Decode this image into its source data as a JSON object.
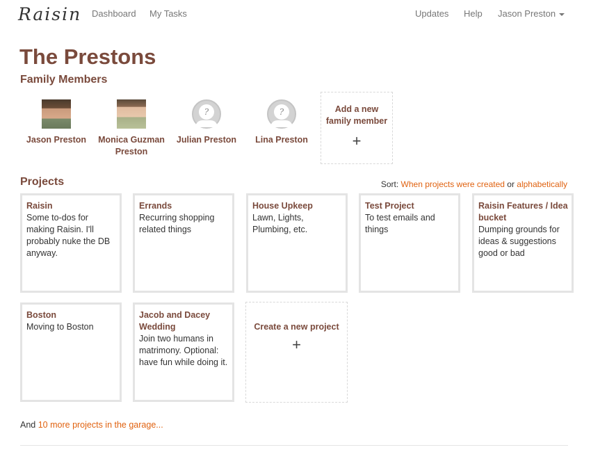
{
  "nav": {
    "brand": "Raisin",
    "links": [
      "Dashboard",
      "My Tasks"
    ],
    "right_links": [
      "Updates",
      "Help"
    ],
    "user": "Jason Preston"
  },
  "page": {
    "title": "The Prestons",
    "members_heading": "Family Members",
    "projects_heading": "Projects"
  },
  "members": [
    {
      "name": "Jason Preston",
      "avatar": "photo"
    },
    {
      "name": "Monica Guzman Preston",
      "avatar": "photo"
    },
    {
      "name": "Julian Preston",
      "avatar": "default-avatar-icon"
    },
    {
      "name": "Lina Preston",
      "avatar": "default-avatar-icon"
    }
  ],
  "add_member": {
    "label": "Add a new family member",
    "icon": "+"
  },
  "sort": {
    "prefix": "Sort:",
    "option_created": "When projects were created",
    "separator": "or",
    "option_alpha": "alphabetically"
  },
  "projects": [
    {
      "title": "Raisin",
      "desc": "Some to-dos for making Raisin. I'll probably nuke the DB anyway."
    },
    {
      "title": "Errands",
      "desc": "Recurring shopping related things"
    },
    {
      "title": "House Upkeep",
      "desc": "Lawn, Lights, Plumbing, etc."
    },
    {
      "title": "Test Project",
      "desc": "To test emails and things"
    },
    {
      "title": "Raisin Features / Idea bucket",
      "desc": "Dumping grounds for ideas & suggestions good or bad"
    },
    {
      "title": "Boston",
      "desc": "Moving to Boston"
    },
    {
      "title": "Jacob and Dacey Wedding",
      "desc": "Join two humans in matrimony. Optional: have fun while doing it."
    }
  ],
  "new_project": {
    "label": "Create a new project",
    "icon": "+"
  },
  "footer": {
    "prefix": "And",
    "link": "10 more projects in the garage..."
  },
  "colors": {
    "accent_brown": "#7a4a3c",
    "link_orange": "#e06210",
    "card_border": "#e4e4e4"
  }
}
